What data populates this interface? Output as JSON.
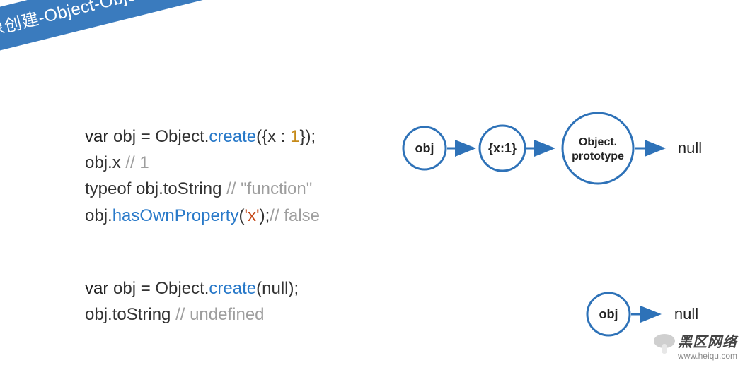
{
  "ribbon": {
    "title": "对象创建-Object-Object.create"
  },
  "code": {
    "block1": {
      "l1": {
        "kw": "var",
        "ident": " obj = Object.",
        "method": "create",
        "open": "({x : ",
        "num": "1",
        "close": "});"
      },
      "l2": {
        "text": "obj.x ",
        "comment": "// 1"
      },
      "l3": {
        "text": "typeof obj.toString ",
        "comment": "// \"function\""
      },
      "l4": {
        "pre": "obj.",
        "method": "hasOwnProperty",
        "open": "(",
        "str": "'x'",
        "close": ");",
        "comment": "// false"
      }
    },
    "block2": {
      "l1": {
        "kw": "var",
        "ident": " obj = Object.",
        "method": "create",
        "open": "(",
        "arg": "null",
        "close": ");"
      },
      "l2": {
        "text": "obj.toString ",
        "comment": "// undefined"
      }
    }
  },
  "diagram1": {
    "n1": "obj",
    "n2": "{x:1}",
    "n3a": "Object.",
    "n3b": "prototype",
    "end": "null"
  },
  "diagram2": {
    "n1": "obj",
    "end": "null"
  },
  "watermark": {
    "brand": "黑区网络",
    "url": "www.heiqu.com"
  }
}
